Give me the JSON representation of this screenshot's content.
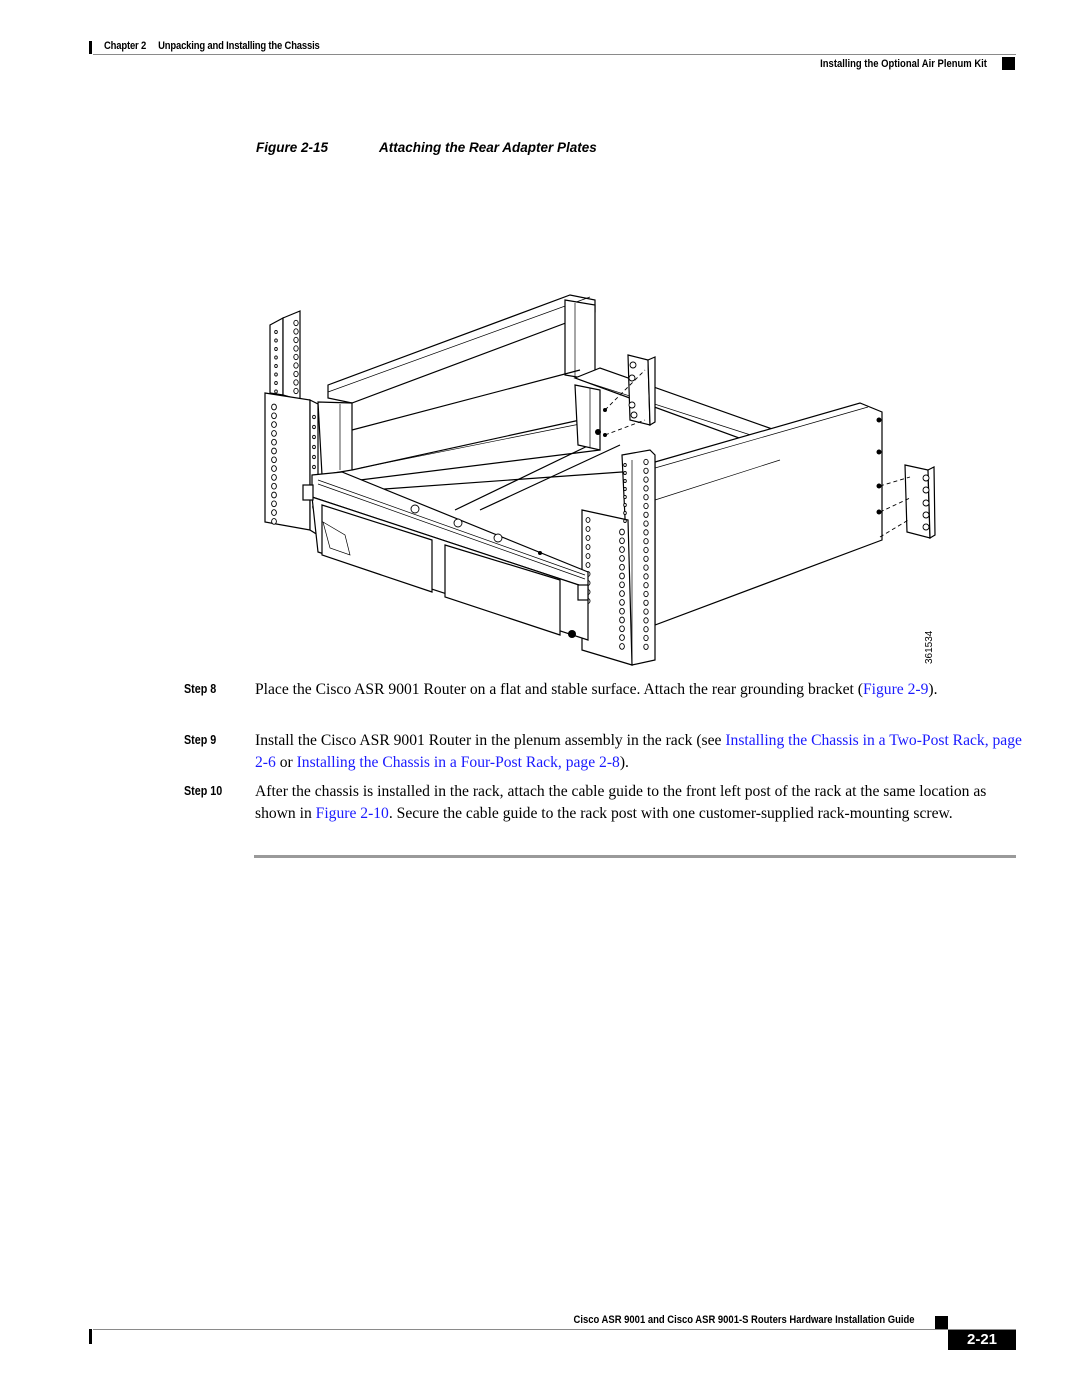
{
  "header": {
    "chapter_label": "Chapter 2",
    "chapter_title": "Unpacking and Installing the Chassis",
    "section_title": "Installing the Optional Air Plenum Kit"
  },
  "figure": {
    "label": "Figure 2-15",
    "title": "Attaching the Rear Adapter Plates",
    "image_id": "361534",
    "illustration": "Isometric line drawing of router chassis with air plenum frame mounted between rack posts; rear adapter plates shown with dashed alignment lines"
  },
  "steps": [
    {
      "label": "Step 8",
      "segments": [
        {
          "text": "Place the Cisco ASR 9001 Router on a flat and stable surface. Attach the rear grounding bracket (",
          "link": false
        },
        {
          "text": "Figure 2-9",
          "link": true
        },
        {
          "text": ").",
          "link": false
        }
      ]
    },
    {
      "label": "Step 9",
      "segments": [
        {
          "text": "Install the Cisco ASR 9001 Router in the plenum assembly in the rack (see ",
          "link": false
        },
        {
          "text": "Installing the Chassis in a Two-Post Rack, page 2-6",
          "link": true
        },
        {
          "text": " or ",
          "link": false
        },
        {
          "text": "Installing the Chassis in a Four-Post Rack, page 2-8",
          "link": true
        },
        {
          "text": ").",
          "link": false
        }
      ]
    },
    {
      "label": "Step 10",
      "segments": [
        {
          "text": "After the chassis is installed in the rack, attach the cable guide to the front left post of the rack at the same location as shown in ",
          "link": false
        },
        {
          "text": "Figure 2-10",
          "link": true
        },
        {
          "text": ". Secure the cable guide to the rack post with one customer-supplied rack-mounting screw.",
          "link": false
        }
      ]
    }
  ],
  "footer": {
    "guide_title": "Cisco ASR 9001 and Cisco ASR 9001-S Routers Hardware Installation Guide",
    "page_number": "2-21"
  },
  "colors": {
    "link": "#1a1aff",
    "rule": "#8a8a8a",
    "text": "#000000"
  }
}
